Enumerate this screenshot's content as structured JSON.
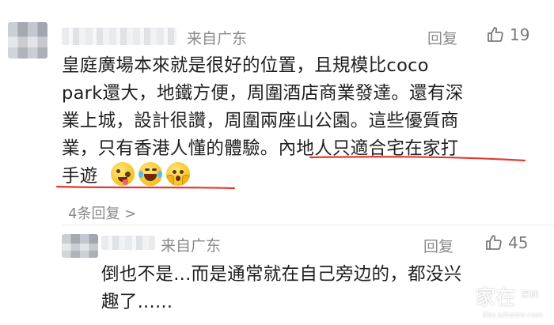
{
  "comments": [
    {
      "source": "来自广东",
      "reply_label": "回复",
      "likes": "19",
      "text_lines": [
        "皇庭廣場本來就是很好的位置，且規模比coco",
        "park還大，地鐵方便，周圍酒店商業發達。還有深",
        "業上城，設計很讚，周圍兩座山公園。這些優質商",
        "業，只有香港人懂的體驗。內地人只適合宅在家打",
        "手遊"
      ],
      "emojis": [
        "zany-face-emoji",
        "laughing-tears-emoji",
        "shocked-hands-emoji"
      ],
      "thread_link": "4条回复 >"
    },
    {
      "source": "来自广东",
      "reply_label": "回复",
      "likes": "45",
      "text_lines": [
        "倒也不是...而是通常就在自己旁边的，都没兴",
        "趣了......"
      ]
    }
  ],
  "watermark": {
    "main": "家在",
    "tag": "深圳",
    "url": "bbs.szhome.com"
  },
  "colors": {
    "underline": "#e23a32",
    "meta_gray": "#8a8a8a",
    "text": "#1f1f1f"
  }
}
